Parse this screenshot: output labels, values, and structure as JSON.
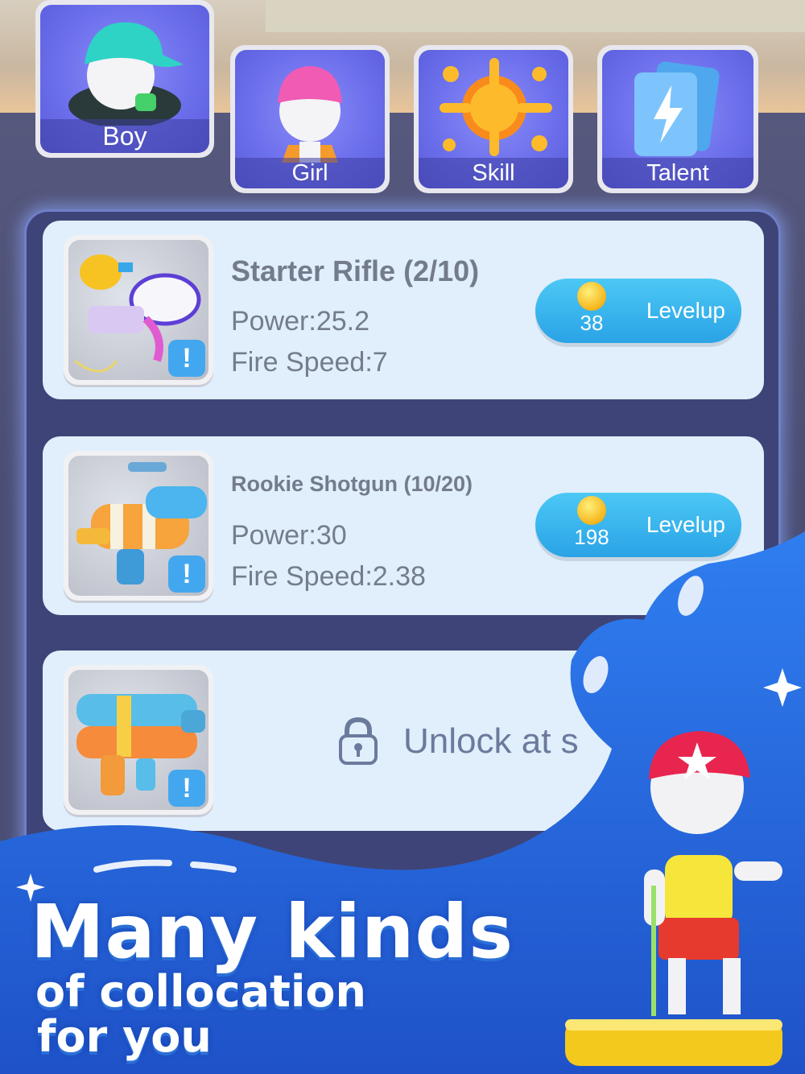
{
  "tabs": [
    {
      "label": "Boy",
      "selected": true
    },
    {
      "label": "Girl",
      "selected": false
    },
    {
      "label": "Skill",
      "selected": false
    },
    {
      "label": "Talent",
      "selected": false
    }
  ],
  "weapons": [
    {
      "name": "Starter Rifle (2/10)",
      "power": "Power:25.2",
      "fire_speed": "Fire Speed:7",
      "cost": "38",
      "button": "Levelup"
    },
    {
      "name": "Rookie Shotgun (10/20)",
      "power": "Power:30",
      "fire_speed": "Fire Speed:2.38",
      "cost": "198",
      "button": "Levelup"
    },
    {
      "locked_text": "Unlock at s"
    }
  ],
  "promo": {
    "headline": "Many kinds",
    "line2": "of collocation",
    "line3": "for you"
  },
  "colors": {
    "accent_blue": "#2aa3e6",
    "panel": "#3e4477",
    "card": "#e0effb",
    "tab_purple": "#6d70ec",
    "splash_blue": "#2f7ef0"
  }
}
